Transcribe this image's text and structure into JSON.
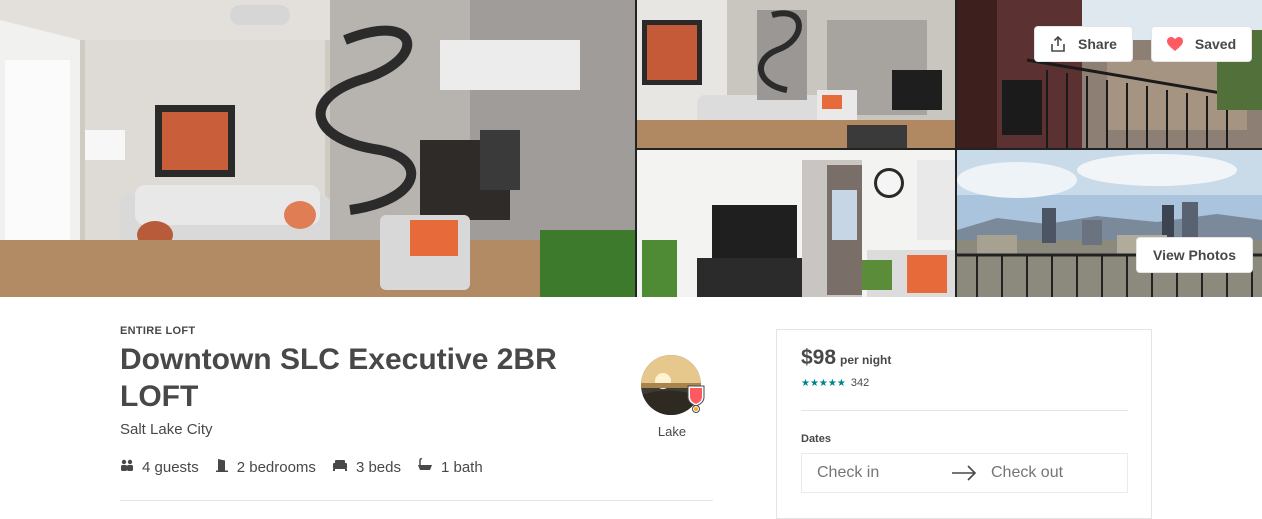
{
  "gallery": {
    "photos": [
      {
        "name": "living-room-spiral-stair"
      },
      {
        "name": "living-room-wide"
      },
      {
        "name": "balcony-view"
      },
      {
        "name": "tv-and-balcony-door"
      },
      {
        "name": "city-skyline"
      }
    ],
    "share_label": "Share",
    "saved_label": "Saved",
    "view_photos_label": "View Photos",
    "icons": {
      "share": "share-icon",
      "saved": "heart-icon"
    },
    "colors": {
      "heart": "#FF5A5F"
    }
  },
  "listing": {
    "kind": "ENTIRE LOFT",
    "title": "Downtown SLC Executive 2BR LOFT",
    "city": "Salt Lake City",
    "facts": [
      {
        "icon": "guests-icon",
        "label": "4 guests"
      },
      {
        "icon": "door-icon",
        "label": "2 bedrooms"
      },
      {
        "icon": "bed-icon",
        "label": "3 beds"
      },
      {
        "icon": "bath-icon",
        "label": "1 bath"
      }
    ]
  },
  "host": {
    "name": "Lake",
    "badge": "superhost-badge-icon"
  },
  "booking": {
    "price": "$98",
    "price_unit": "per night",
    "stars": "★★★★★",
    "review_count": "342",
    "dates_label": "Dates",
    "checkin_placeholder": "Check in",
    "checkout_placeholder": "Check out",
    "colors": {
      "stars": "#008489"
    }
  }
}
